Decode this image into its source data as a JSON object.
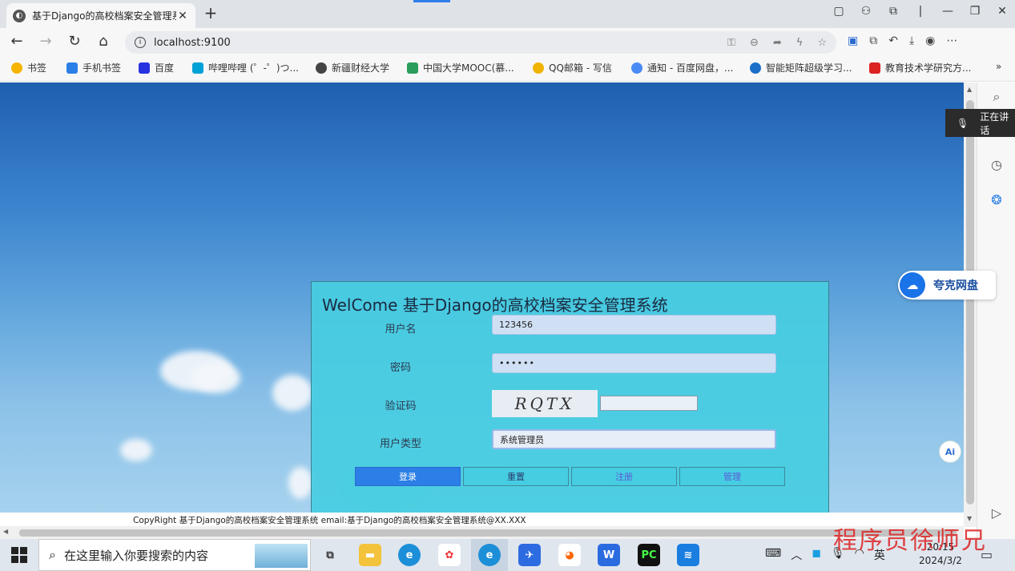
{
  "browser": {
    "tab_title": "基于Django的高校档案安全管理系",
    "url": "localhost:9100"
  },
  "bookmarks": [
    {
      "label": "书签"
    },
    {
      "label": "手机书签"
    },
    {
      "label": "百度"
    },
    {
      "label": "哔哩哔哩 (゜-゜)つ..."
    },
    {
      "label": "新疆财经大学"
    },
    {
      "label": "中国大学MOOC(慕..."
    },
    {
      "label": "QQ邮箱 - 写信"
    },
    {
      "label": "通知 - 百度网盘，..."
    },
    {
      "label": "智能矩阵超级学习..."
    },
    {
      "label": "教育技术学研究方..."
    }
  ],
  "login": {
    "title": "WelCome 基于Django的高校档案安全管理系统",
    "username_label": "用户名",
    "username_value": "123456",
    "password_label": "密码",
    "password_value": "••••••",
    "captcha_label": "验证码",
    "captcha_text": "RQTX",
    "usertype_label": "用户类型",
    "usertype_value": "系统管理员",
    "buttons": {
      "login": "登录",
      "reset": "重置",
      "register": "注册",
      "admin": "管理"
    }
  },
  "footer": {
    "copyright": "CopyRight 基于Django的高校档案安全管理系统 email:基于Django的高校档案安全管理系统@XX.XXX"
  },
  "overlays": {
    "quark_label": "夸克网盘",
    "meeting_text": "正在讲话",
    "ai_label": "Ai"
  },
  "taskbar": {
    "search_placeholder": "在这里输入你要搜索的内容",
    "ime": "英",
    "time": "20:15",
    "date": "2024/3/2"
  },
  "watermark": "程序员徐师兄"
}
